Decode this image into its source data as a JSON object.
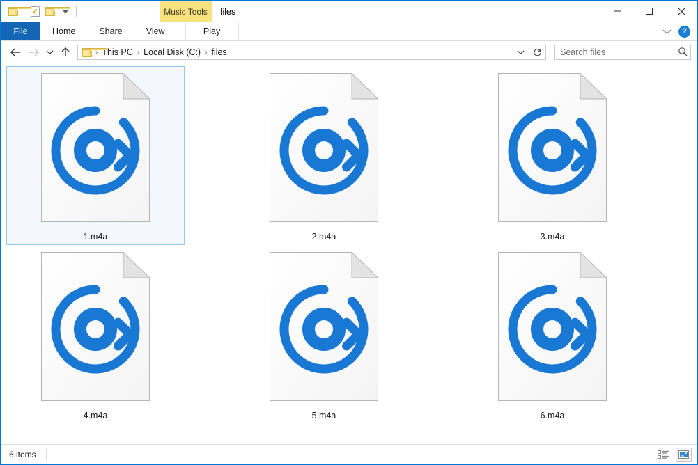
{
  "window": {
    "title": "files",
    "contextual_tab_group": "Music Tools",
    "accent_color": "#1266b5",
    "border_color": "#0078d7",
    "icon_color": "#1878d4",
    "contextual_tab_color": "#f7e27f"
  },
  "quick_access": {
    "items": [
      {
        "name": "new-folder-icon",
        "label": "New folder"
      },
      {
        "name": "properties-icon",
        "label": "Properties"
      },
      {
        "name": "open-folder-icon",
        "label": "Open"
      },
      {
        "name": "customize-caret-icon",
        "label": "Customize Quick Access Toolbar"
      }
    ]
  },
  "window_controls": {
    "minimize": "Minimize",
    "maximize": "Maximize",
    "close": "Close"
  },
  "ribbon": {
    "tabs": [
      {
        "label": "File",
        "selected": false,
        "kind": "file"
      },
      {
        "label": "Home",
        "selected": false,
        "kind": "normal"
      },
      {
        "label": "Share",
        "selected": false,
        "kind": "normal"
      },
      {
        "label": "View",
        "selected": false,
        "kind": "normal"
      },
      {
        "label": "Play",
        "selected": false,
        "kind": "contextual"
      }
    ],
    "collapse_label": "Minimize the Ribbon",
    "help_label": "?"
  },
  "navigation": {
    "back": "Back",
    "forward": "Forward",
    "recent": "Recent locations",
    "up": "Up one level"
  },
  "breadcrumb": {
    "separator": "›",
    "items": [
      "This PC",
      "Local Disk (C:)",
      "files"
    ]
  },
  "address": {
    "dropdown_label": "Previous locations",
    "refresh_label": "Refresh"
  },
  "search": {
    "placeholder": "Search files",
    "value": ""
  },
  "files": [
    {
      "name": "1.m4a",
      "selected": true,
      "icon": "audio-file-icon"
    },
    {
      "name": "2.m4a",
      "selected": false,
      "icon": "audio-file-icon"
    },
    {
      "name": "3.m4a",
      "selected": false,
      "icon": "audio-file-icon"
    },
    {
      "name": "4.m4a",
      "selected": false,
      "icon": "audio-file-icon"
    },
    {
      "name": "5.m4a",
      "selected": false,
      "icon": "audio-file-icon"
    },
    {
      "name": "6.m4a",
      "selected": false,
      "icon": "audio-file-icon"
    }
  ],
  "status": {
    "item_count": "6 items",
    "details_view_label": "Details view",
    "large_icons_view_label": "Large icons view"
  }
}
